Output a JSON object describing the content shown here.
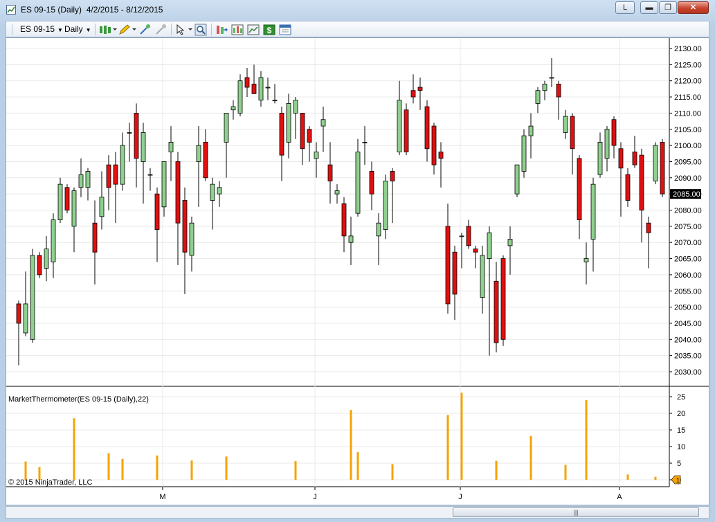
{
  "window": {
    "title": "ES 09-15 (Daily)  4/2/2015 - 8/12/2015",
    "extra_button": "L"
  },
  "toolbar": {
    "instrument": "ES 09-15",
    "period": "Daily"
  },
  "chart": {
    "price_axis_labels": [
      "2130.00",
      "2125.00",
      "2120.00",
      "2115.00",
      "2110.00",
      "2105.00",
      "2100.00",
      "2095.00",
      "2090.00",
      "2085.00",
      "2080.00",
      "2075.00",
      "2070.00",
      "2065.00",
      "2060.00",
      "2055.00",
      "2050.00",
      "2045.00",
      "2040.00",
      "2035.00",
      "2030.00"
    ],
    "last_price_label": "2085.00",
    "indicator_label": "MarketThermometer(ES 09-15 (Daily),22)",
    "indicator_axis_labels": [
      "25",
      "20",
      "15",
      "10",
      "5",
      "0"
    ],
    "x_axis_labels": [
      "M",
      "J",
      "J",
      "A"
    ],
    "copyright": "© 2015 NinjaTrader, LLC"
  },
  "colors": {
    "up_candle": "#8fd08f",
    "down_candle": "#e01010",
    "indicator_bar": "#f5a300",
    "last_price_bg": "#000000"
  },
  "chart_data": {
    "type": "candlestick",
    "title": "ES 09-15 (Daily)",
    "y_range": [
      2028,
      2132
    ],
    "candles": [
      {
        "o": 2051,
        "h": 2052,
        "l": 2032,
        "c": 2045
      },
      {
        "o": 2042,
        "h": 2061,
        "l": 2041,
        "c": 2051
      },
      {
        "o": 2040,
        "h": 2068,
        "l": 2039,
        "c": 2066
      },
      {
        "o": 2066,
        "h": 2067,
        "l": 2059,
        "c": 2060
      },
      {
        "o": 2062,
        "h": 2072,
        "l": 2058,
        "c": 2068
      },
      {
        "o": 2064,
        "h": 2079,
        "l": 2059,
        "c": 2077
      },
      {
        "o": 2077,
        "h": 2090,
        "l": 2076,
        "c": 2088
      },
      {
        "o": 2087,
        "h": 2088,
        "l": 2079,
        "c": 2080
      },
      {
        "o": 2075,
        "h": 2087,
        "l": 2067,
        "c": 2086
      },
      {
        "o": 2087,
        "h": 2096,
        "l": 2084,
        "c": 2091
      },
      {
        "o": 2087,
        "h": 2093,
        "l": 2083,
        "c": 2092
      },
      {
        "o": 2076,
        "h": 2083,
        "l": 2057,
        "c": 2067
      },
      {
        "o": 2078,
        "h": 2092,
        "l": 2074,
        "c": 2084
      },
      {
        "o": 2094,
        "h": 2097,
        "l": 2080,
        "c": 2087
      },
      {
        "o": 2094,
        "h": 2098,
        "l": 2076,
        "c": 2088
      },
      {
        "o": 2088,
        "h": 2104,
        "l": 2086,
        "c": 2100
      },
      {
        "o": 2104,
        "h": 2107,
        "l": 2095,
        "c": 2104
      },
      {
        "o": 2110,
        "h": 2113,
        "l": 2087,
        "c": 2096
      },
      {
        "o": 2095,
        "h": 2107,
        "l": 2082,
        "c": 2104
      },
      {
        "o": 2091,
        "h": 2093,
        "l": 2086,
        "c": 2091
      },
      {
        "o": 2085,
        "h": 2087,
        "l": 2064,
        "c": 2074
      },
      {
        "o": 2081,
        "h": 2095,
        "l": 2078,
        "c": 2095
      },
      {
        "o": 2098,
        "h": 2106,
        "l": 2089,
        "c": 2101
      },
      {
        "o": 2095,
        "h": 2098,
        "l": 2063,
        "c": 2076
      },
      {
        "o": 2083,
        "h": 2087,
        "l": 2054,
        "c": 2067
      },
      {
        "o": 2066,
        "h": 2078,
        "l": 2061,
        "c": 2076
      },
      {
        "o": 2095,
        "h": 2106,
        "l": 2081,
        "c": 2100
      },
      {
        "o": 2101,
        "h": 2105,
        "l": 2089,
        "c": 2090
      },
      {
        "o": 2083,
        "h": 2090,
        "l": 2074,
        "c": 2088
      },
      {
        "o": 2085,
        "h": 2089,
        "l": 2081,
        "c": 2087
      },
      {
        "o": 2101,
        "h": 2108,
        "l": 2090,
        "c": 2110
      },
      {
        "o": 2111,
        "h": 2114,
        "l": 2108,
        "c": 2112
      },
      {
        "o": 2110,
        "h": 2122,
        "l": 2109,
        "c": 2120
      },
      {
        "o": 2121,
        "h": 2124,
        "l": 2115,
        "c": 2118
      },
      {
        "o": 2119,
        "h": 2125,
        "l": 2116,
        "c": 2116
      },
      {
        "o": 2114,
        "h": 2123,
        "l": 2112,
        "c": 2121
      },
      {
        "o": 2118,
        "h": 2121,
        "l": 2114,
        "c": 2118
      },
      {
        "o": 2114,
        "h": 2119,
        "l": 2113,
        "c": 2114
      },
      {
        "o": 2110,
        "h": 2112,
        "l": 2089,
        "c": 2097
      },
      {
        "o": 2101,
        "h": 2116,
        "l": 2096,
        "c": 2113
      },
      {
        "o": 2110,
        "h": 2115,
        "l": 2102,
        "c": 2114
      },
      {
        "o": 2110,
        "h": 2110,
        "l": 2094,
        "c": 2099
      },
      {
        "o": 2105,
        "h": 2106,
        "l": 2095,
        "c": 2101
      },
      {
        "o": 2096,
        "h": 2101,
        "l": 2090,
        "c": 2098
      },
      {
        "o": 2106,
        "h": 2112,
        "l": 2098,
        "c": 2108
      },
      {
        "o": 2094,
        "h": 2101,
        "l": 2082,
        "c": 2089
      },
      {
        "o": 2085,
        "h": 2088,
        "l": 2082,
        "c": 2086
      },
      {
        "o": 2082,
        "h": 2084,
        "l": 2067,
        "c": 2072
      },
      {
        "o": 2070,
        "h": 2078,
        "l": 2063,
        "c": 2072
      },
      {
        "o": 2079,
        "h": 2102,
        "l": 2078,
        "c": 2098
      },
      {
        "o": 2101,
        "h": 2106,
        "l": 2094,
        "c": 2101
      },
      {
        "o": 2092,
        "h": 2095,
        "l": 2080,
        "c": 2085
      },
      {
        "o": 2072,
        "h": 2079,
        "l": 2063,
        "c": 2076
      },
      {
        "o": 2074,
        "h": 2091,
        "l": 2071,
        "c": 2089
      },
      {
        "o": 2092,
        "h": 2093,
        "l": 2076,
        "c": 2089
      },
      {
        "o": 2098,
        "h": 2120,
        "l": 2097,
        "c": 2114
      },
      {
        "o": 2111,
        "h": 2113,
        "l": 2097,
        "c": 2098
      },
      {
        "o": 2117,
        "h": 2122,
        "l": 2113,
        "c": 2115
      },
      {
        "o": 2118,
        "h": 2121,
        "l": 2111,
        "c": 2117
      },
      {
        "o": 2112,
        "h": 2114,
        "l": 2095,
        "c": 2099
      },
      {
        "o": 2106,
        "h": 2107,
        "l": 2091,
        "c": 2094
      },
      {
        "o": 2098,
        "h": 2101,
        "l": 2087,
        "c": 2096
      },
      {
        "o": 2075,
        "h": 2082,
        "l": 2048,
        "c": 2051
      },
      {
        "o": 2067,
        "h": 2069,
        "l": 2046,
        "c": 2054
      },
      {
        "o": 2072,
        "h": 2073,
        "l": 2062,
        "c": 2072
      },
      {
        "o": 2075,
        "h": 2077,
        "l": 2068,
        "c": 2069
      },
      {
        "o": 2068,
        "h": 2069,
        "l": 2062,
        "c": 2067
      },
      {
        "o": 2053,
        "h": 2069,
        "l": 2048,
        "c": 2066
      },
      {
        "o": 2065,
        "h": 2075,
        "l": 2035,
        "c": 2073
      },
      {
        "o": 2058,
        "h": 2064,
        "l": 2036,
        "c": 2039
      },
      {
        "o": 2065,
        "h": 2066,
        "l": 2038,
        "c": 2040
      },
      {
        "o": 2069,
        "h": 2075,
        "l": 2060,
        "c": 2071
      },
      {
        "o": 2085,
        "h": 2094,
        "l": 2084,
        "c": 2094
      },
      {
        "o": 2092,
        "h": 2105,
        "l": 2090,
        "c": 2103
      },
      {
        "o": 2103,
        "h": 2110,
        "l": 2096,
        "c": 2106
      },
      {
        "o": 2113,
        "h": 2118,
        "l": 2110,
        "c": 2117
      },
      {
        "o": 2117,
        "h": 2120,
        "l": 2114,
        "c": 2119
      },
      {
        "o": 2121,
        "h": 2127,
        "l": 2118,
        "c": 2121
      },
      {
        "o": 2119,
        "h": 2120,
        "l": 2108,
        "c": 2115
      },
      {
        "o": 2104,
        "h": 2111,
        "l": 2102,
        "c": 2109
      },
      {
        "o": 2109,
        "h": 2110,
        "l": 2091,
        "c": 2099
      },
      {
        "o": 2096,
        "h": 2097,
        "l": 2071,
        "c": 2077
      },
      {
        "o": 2064,
        "h": 2070,
        "l": 2057,
        "c": 2065
      },
      {
        "o": 2071,
        "h": 2090,
        "l": 2061,
        "c": 2088
      },
      {
        "o": 2091,
        "h": 2104,
        "l": 2090,
        "c": 2101
      },
      {
        "o": 2096,
        "h": 2106,
        "l": 2092,
        "c": 2105
      },
      {
        "o": 2108,
        "h": 2109,
        "l": 2096,
        "c": 2100
      },
      {
        "o": 2099,
        "h": 2101,
        "l": 2078,
        "c": 2093
      },
      {
        "o": 2091,
        "h": 2093,
        "l": 2081,
        "c": 2083
      },
      {
        "o": 2098,
        "h": 2103,
        "l": 2093,
        "c": 2094
      },
      {
        "o": 2097,
        "h": 2099,
        "l": 2070,
        "c": 2080
      },
      {
        "o": 2076,
        "h": 2078,
        "l": 2062,
        "c": 2073
      },
      {
        "o": 2089,
        "h": 2101,
        "l": 2088,
        "c": 2100
      },
      {
        "o": 2101,
        "h": 2102,
        "l": 2084,
        "c": 2085
      }
    ],
    "indicator": {
      "name": "MarketThermometer(ES 09-15 (Daily),22)",
      "y_range": [
        0,
        27
      ],
      "bars": [
        {
          "i": 1,
          "v": 5.5
        },
        {
          "i": 3,
          "v": 3.8
        },
        {
          "i": 8,
          "v": 18.5
        },
        {
          "i": 13,
          "v": 8
        },
        {
          "i": 15,
          "v": 6.3
        },
        {
          "i": 20,
          "v": 7.3
        },
        {
          "i": 25,
          "v": 5.8
        },
        {
          "i": 30,
          "v": 7
        },
        {
          "i": 40,
          "v": 5.6
        },
        {
          "i": 48,
          "v": 21
        },
        {
          "i": 49,
          "v": 8.3
        },
        {
          "i": 54,
          "v": 4.7
        },
        {
          "i": 62,
          "v": 19.5
        },
        {
          "i": 64,
          "v": 26.2
        },
        {
          "i": 69,
          "v": 5.7
        },
        {
          "i": 74,
          "v": 13.2
        },
        {
          "i": 79,
          "v": 4.5
        },
        {
          "i": 82,
          "v": 24
        },
        {
          "i": 88,
          "v": 1.6
        },
        {
          "i": 92,
          "v": 0.9
        }
      ]
    }
  }
}
